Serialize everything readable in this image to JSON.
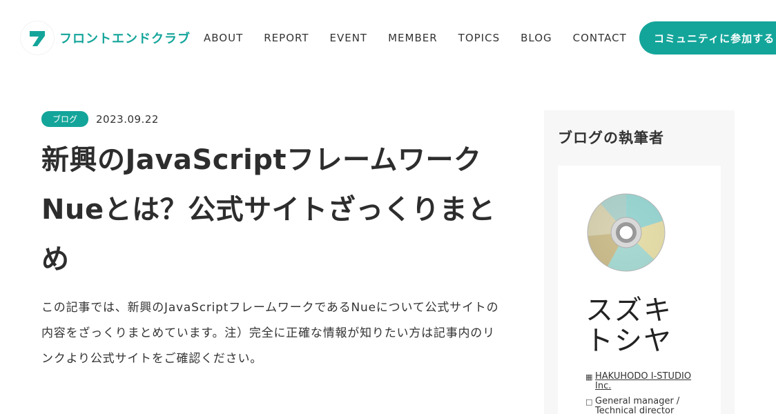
{
  "brand": {
    "name": "フロントエンドクラブ",
    "color": "#14a59a"
  },
  "nav": {
    "items": [
      "ABOUT",
      "REPORT",
      "EVENT",
      "MEMBER",
      "TOPICS",
      "BLOG",
      "CONTACT"
    ],
    "cta": "コミュニティに参加する"
  },
  "article": {
    "tag": "ブログ",
    "date": "2023.09.22",
    "title": "新興のJavaScriptフレームワークNueとは？公式サイトざっくりまとめ",
    "lead": "この記事では、新興のJavaScriptフレームワークであるNueについて公式サイトの内容をざっくりまとめています。注）完全に正確な情報が知りたい方は記事内のリンクより公式サイトをご確認ください。"
  },
  "sidebar": {
    "heading": "ブログの執筆者",
    "author": {
      "name": "スズキトシヤ",
      "company": "HAKUHODO I-STUDIO Inc.",
      "role": "General manager / Technical director"
    }
  },
  "icons": {
    "logo": "brand-logo-icon",
    "avatar": "cd-disc-avatar",
    "company": "building-icon",
    "role": "briefcase-icon"
  }
}
